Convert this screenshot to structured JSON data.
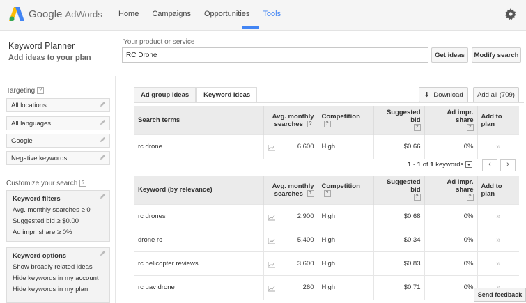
{
  "brand": {
    "google": "Google",
    "adwords": "AdWords"
  },
  "nav": [
    "Home",
    "Campaigns",
    "Opportunities",
    "Tools"
  ],
  "nav_active": "Tools",
  "header": {
    "title": "Keyword Planner",
    "subtitle": "Add ideas to your plan",
    "product_label": "Your product or service",
    "product_value": "RC Drone",
    "get_ideas": "Get ideas",
    "modify_search": "Modify search"
  },
  "targeting": {
    "label": "Targeting",
    "help": "?",
    "items": [
      "All locations",
      "All languages",
      "Google",
      "Negative keywords"
    ]
  },
  "customize": {
    "label": "Customize your search",
    "help": "?",
    "filters_title": "Keyword filters",
    "filters": [
      "Avg. monthly searches ≥ 0",
      "Suggested bid ≥ $0.00",
      "Ad impr. share ≥ 0%"
    ],
    "options_title": "Keyword options",
    "options": [
      "Show broadly related ideas",
      "Hide keywords in my account",
      "Hide keywords in my plan"
    ]
  },
  "tabs": [
    "Ad group ideas",
    "Keyword ideas"
  ],
  "tab_active": "Keyword ideas",
  "actions": {
    "download": "Download",
    "add_all": "Add all (709)"
  },
  "search_table": {
    "headers": [
      "Search terms",
      "Avg. monthly searches",
      "Competition",
      "Suggested bid",
      "Ad impr. share",
      "Add to plan"
    ],
    "help": "?",
    "rows": [
      {
        "term": "rc drone",
        "searches": "6,600",
        "competition": "High",
        "bid": "$0.66",
        "share": "0%"
      }
    ]
  },
  "pager": {
    "range_start": "1",
    "range_end": "1",
    "of": "of",
    "total": "1",
    "unit": "keywords",
    "dash": "-",
    "prev": "‹",
    "next": "›"
  },
  "ideas_table": {
    "headers": [
      "Keyword (by relevance)",
      "Avg. monthly searches",
      "Competition",
      "Suggested bid",
      "Ad impr. share",
      "Add to plan"
    ],
    "help": "?",
    "rows": [
      {
        "term": "rc drones",
        "searches": "2,900",
        "competition": "High",
        "bid": "$0.68",
        "share": "0%"
      },
      {
        "term": "drone rc",
        "searches": "5,400",
        "competition": "High",
        "bid": "$0.34",
        "share": "0%"
      },
      {
        "term": "rc helicopter reviews",
        "searches": "3,600",
        "competition": "High",
        "bid": "$0.83",
        "share": "0%"
      },
      {
        "term": "rc uav drone",
        "searches": "260",
        "competition": "High",
        "bid": "$0.71",
        "share": "0%"
      }
    ]
  },
  "add_arrow": "»",
  "feedback": "Send feedback",
  "colors": {
    "accent": "#4285f4",
    "header_bg": "#f5f5f5"
  }
}
